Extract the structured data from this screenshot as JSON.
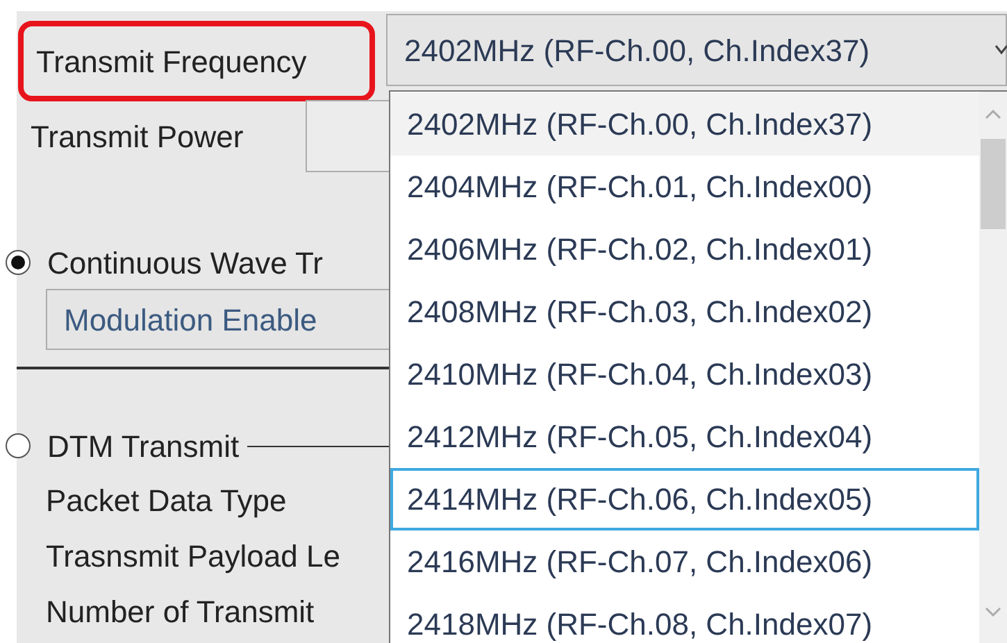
{
  "frequency": {
    "label": "Transmit Frequency",
    "highlighted": true,
    "value": "2402MHz (RF-Ch.00, Ch.Index37)",
    "expanded": true
  },
  "power": {
    "label": "Transmit Power"
  },
  "modes": [
    {
      "label": "Continuous Wave Tr",
      "selected": true
    },
    {
      "label": "DTM Transmit",
      "selected": false
    }
  ],
  "modulation": {
    "value": "Modulation Enable"
  },
  "dtm_fields": [
    "Packet Data Type",
    "Trasnsmit Payload Le",
    "Number of Transmit"
  ],
  "options": [
    {
      "label": "2402MHz (RF-Ch.00, Ch.Index37)",
      "selected": true,
      "focused": false
    },
    {
      "label": "2404MHz (RF-Ch.01, Ch.Index00)",
      "selected": false,
      "focused": false
    },
    {
      "label": "2406MHz (RF-Ch.02, Ch.Index01)",
      "selected": false,
      "focused": false
    },
    {
      "label": "2408MHz (RF-Ch.03, Ch.Index02)",
      "selected": false,
      "focused": false
    },
    {
      "label": "2410MHz (RF-Ch.04, Ch.Index03)",
      "selected": false,
      "focused": false
    },
    {
      "label": "2412MHz (RF-Ch.05, Ch.Index04)",
      "selected": false,
      "focused": false
    },
    {
      "label": "2414MHz (RF-Ch.06, Ch.Index05)",
      "selected": false,
      "focused": true
    },
    {
      "label": "2416MHz (RF-Ch.07, Ch.Index06)",
      "selected": false,
      "focused": false
    },
    {
      "label": "2418MHz (RF-Ch.08, Ch.Index07)",
      "selected": false,
      "focused": false
    }
  ]
}
